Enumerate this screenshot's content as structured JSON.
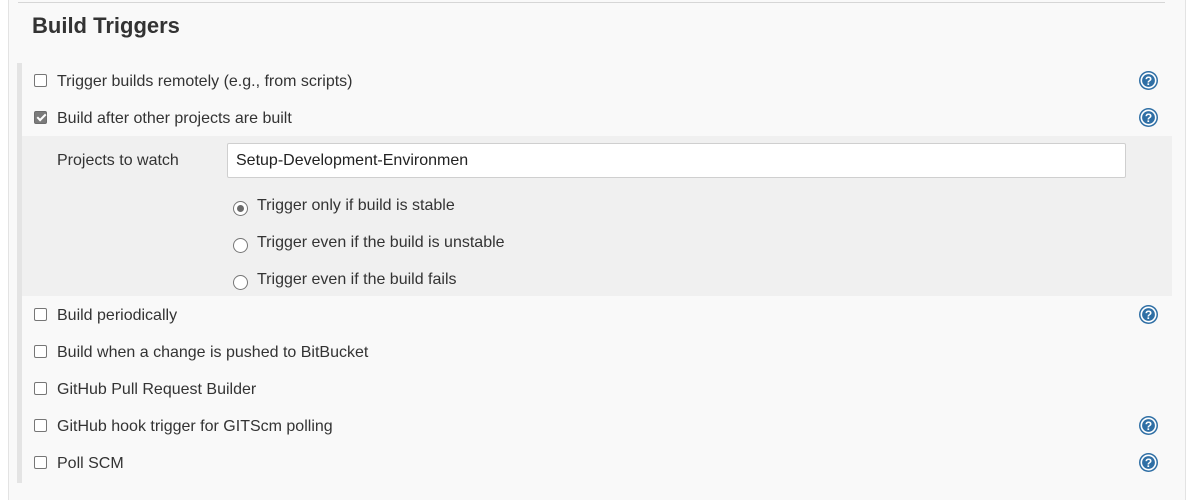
{
  "section": {
    "title": "Build Triggers"
  },
  "triggers": {
    "remote": {
      "label": "Trigger builds remotely (e.g., from scripts)",
      "checked": false
    },
    "after_other": {
      "label": "Build after other projects are built",
      "checked": true
    },
    "periodic": {
      "label": "Build periodically",
      "checked": false
    },
    "bitbucket": {
      "label": "Build when a change is pushed to BitBucket",
      "checked": false
    },
    "ghprb": {
      "label": "GitHub Pull Request Builder",
      "checked": false
    },
    "github_hook": {
      "label": "GitHub hook trigger for GITScm polling",
      "checked": false
    },
    "poll_scm": {
      "label": "Poll SCM",
      "checked": false
    }
  },
  "after_other_config": {
    "projects_label": "Projects to watch",
    "projects_value": "Setup-Development-Environmen",
    "options": [
      {
        "label": "Trigger only if build is stable",
        "selected": true
      },
      {
        "label": "Trigger even if the build is unstable",
        "selected": false
      },
      {
        "label": "Trigger even if the build fails",
        "selected": false
      }
    ]
  },
  "colors": {
    "help_icon": "#2f6fa5",
    "panel_bg": "#f9f9f9",
    "subsection_bg": "#f0f0f0"
  },
  "icons": {
    "help": "help-icon"
  }
}
